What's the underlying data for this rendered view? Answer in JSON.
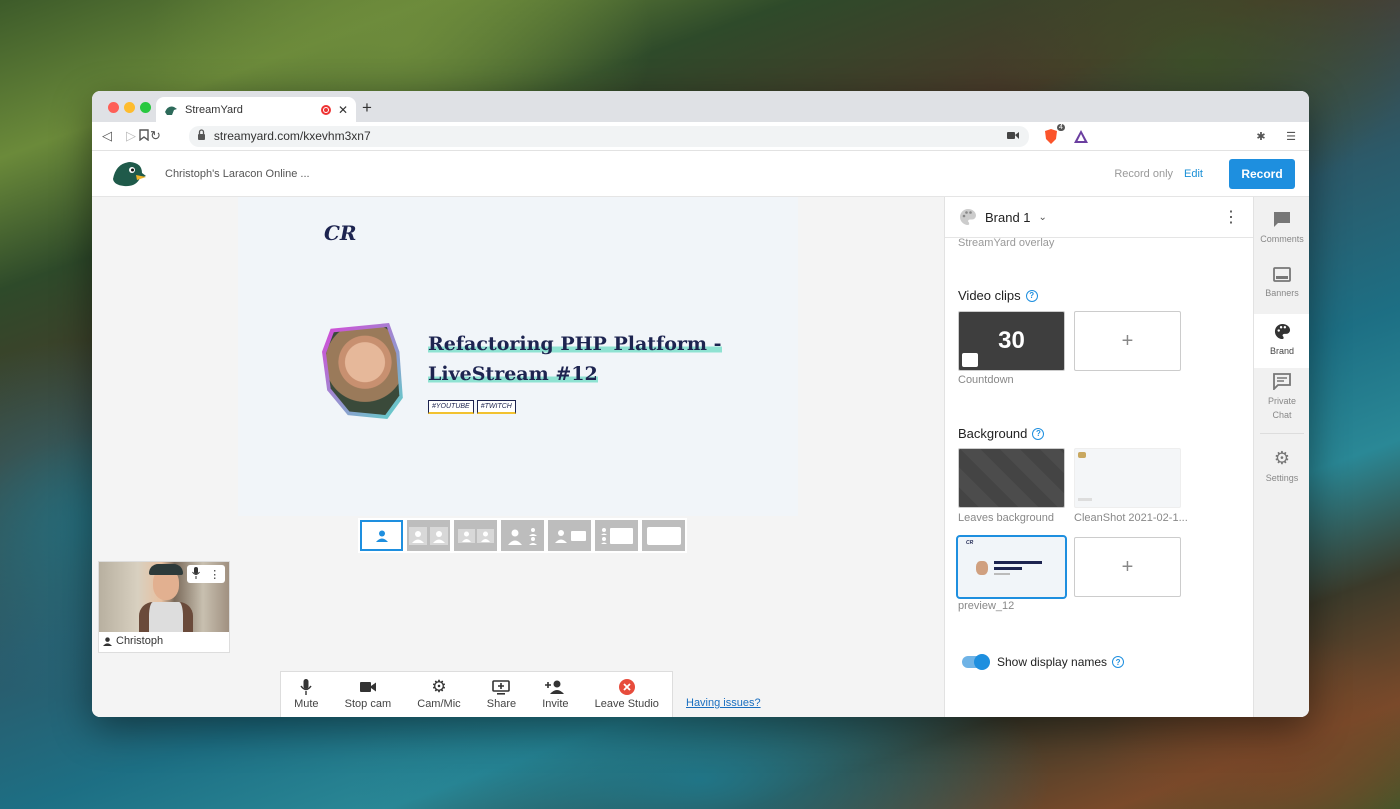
{
  "browser": {
    "tab_title": "StreamYard",
    "new_tab": "+",
    "url": "streamyard.com/kxevhm3xn7",
    "brave_count": "4"
  },
  "appbar": {
    "title": "Christoph's Laracon Online ...",
    "record_only": "Record only",
    "edit": "Edit",
    "record": "Record"
  },
  "stage": {
    "logo": "CR",
    "title_line1": "Refactoring PHP Platform -",
    "title_line2": "LiveStream #12",
    "tags": [
      "#YOUTUBE",
      "#TWITCH"
    ]
  },
  "participant": {
    "name": "Christoph"
  },
  "controls": [
    {
      "label": "Mute",
      "icon": "mic-icon"
    },
    {
      "label": "Stop cam",
      "icon": "camera-icon"
    },
    {
      "label": "Cam/Mic",
      "icon": "gear-icon"
    },
    {
      "label": "Share",
      "icon": "screen-share-icon"
    },
    {
      "label": "Invite",
      "icon": "add-person-icon"
    },
    {
      "label": "Leave Studio",
      "icon": "leave-icon"
    }
  ],
  "having_issues": "Having issues?",
  "panel": {
    "brand": "Brand 1",
    "overlay_label": "StreamYard overlay",
    "video_clips_label": "Video clips",
    "countdown_value": "30",
    "countdown_caption": "Countdown",
    "background_label": "Background",
    "bg1_caption": "Leaves background",
    "bg2_caption": "CleanShot 2021-02-1...",
    "bg3_caption": "preview_12",
    "add": "+",
    "show_display_names": "Show display names"
  },
  "rail": {
    "comments": "Comments",
    "banners": "Banners",
    "brand": "Brand",
    "private_chat_1": "Private",
    "private_chat_2": "Chat",
    "settings": "Settings"
  },
  "colors": {
    "accent": "#1e8fdf",
    "leave": "#e74c3c",
    "stage_text": "#1d2450"
  }
}
